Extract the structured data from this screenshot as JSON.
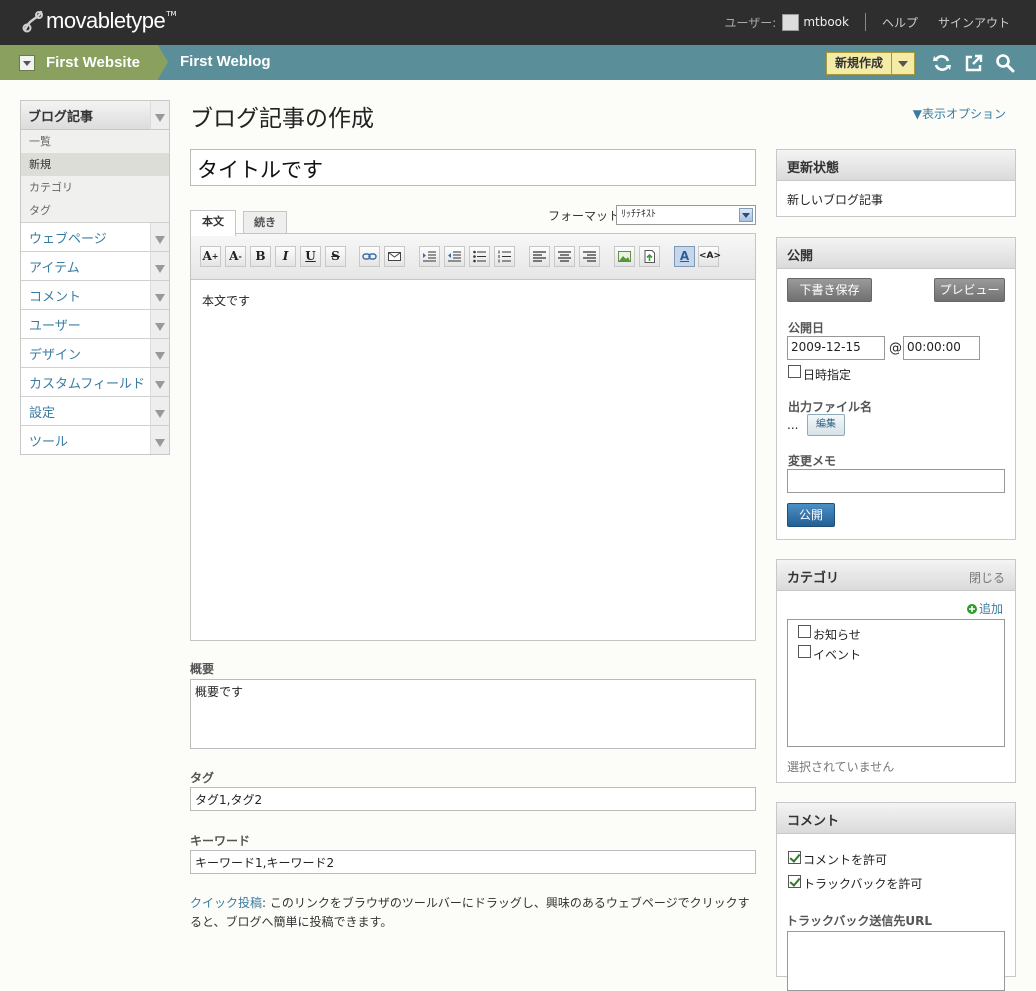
{
  "header": {
    "logo_text": "movabletype",
    "logo_tm": "TM",
    "user_label": "ユーザー:",
    "username": "mtbook",
    "help": "ヘルプ",
    "signout": "サインアウト"
  },
  "nav": {
    "website": "First Website",
    "blog": "First Weblog",
    "new_button": "新規作成"
  },
  "sidebar": {
    "section": "ブログ記事",
    "sub_items": [
      "一覧",
      "新規",
      "カテゴリ",
      "タグ"
    ],
    "active_sub": "新規",
    "items": [
      "ウェブページ",
      "アイテム",
      "コメント",
      "ユーザー",
      "デザイン",
      "カスタムフィールド",
      "設定",
      "ツール"
    ]
  },
  "main": {
    "page_title": "ブログ記事の作成",
    "display_options": "▼表示オプション",
    "title_value": "タイトルです",
    "tab_body": "本文",
    "tab_more": "続き",
    "format_label": "フォーマット:",
    "format_value": "ﾘｯﾁﾃｷｽﾄ",
    "body_text": "本文です",
    "excerpt_label": "概要",
    "excerpt_value": "概要です",
    "tags_label": "タグ",
    "tags_value": "タグ1,タグ2",
    "keywords_label": "キーワード",
    "keywords_value": "キーワード1,キーワード2",
    "quickpost_link": "クイック投稿",
    "quickpost_text": ": このリンクをブラウザのツールバーにドラッグし、興味のあるウェブページでクリックすると、ブログへ簡単に投稿できます。"
  },
  "toolbar_icons": [
    "font-size-increase-icon",
    "font-size-decrease-icon",
    "bold-icon",
    "italic-icon",
    "underline-icon",
    "strikethrough-icon",
    "link-icon",
    "email-link-icon",
    "indent-icon",
    "outdent-icon",
    "bullet-list-icon",
    "numbered-list-icon",
    "align-left-icon",
    "align-center-icon",
    "align-right-icon",
    "insert-image-icon",
    "insert-file-icon",
    "text-color-icon",
    "html-mode-icon"
  ],
  "status_panel": {
    "title": "更新状態",
    "value": "新しいブログ記事"
  },
  "publish_panel": {
    "title": "公開",
    "save_draft": "下書き保存",
    "preview": "プレビュー",
    "date_label": "公開日",
    "date_value": "2009-12-15",
    "at": "@",
    "time_value": "00:00:00",
    "scheduled_label": "日時指定",
    "filename_label": "出力ファイル名",
    "filename_value": "...",
    "edit_button": "編集",
    "memo_label": "変更メモ",
    "publish_button": "公開"
  },
  "category_panel": {
    "title": "カテゴリ",
    "close": "閉じる",
    "add": "追加",
    "categories": [
      "お知らせ",
      "イベント"
    ],
    "none_selected": "選択されていません"
  },
  "comment_panel": {
    "title": "コメント",
    "allow_comments": "コメントを許可",
    "allow_trackbacks": "トラックバックを許可",
    "trackback_label": "トラックバック送信先URL"
  },
  "colors": {
    "topbar": "#2e2e2e",
    "website_nav": "#8aa05e",
    "blog_nav": "#5a8f9a",
    "link": "#3a7ca0",
    "publish_button": "#2a6ba0"
  }
}
